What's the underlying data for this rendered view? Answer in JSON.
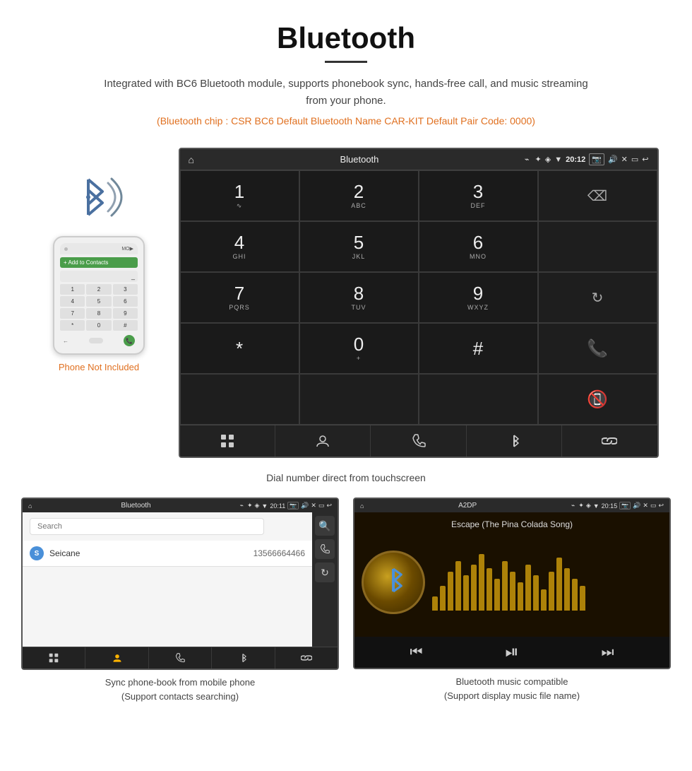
{
  "page": {
    "title": "Bluetooth",
    "title_underline": true,
    "description": "Integrated with BC6 Bluetooth module, supports phonebook sync, hands-free call, and music streaming from your phone.",
    "info_line": "(Bluetooth chip : CSR BC6    Default Bluetooth Name CAR-KIT    Default Pair Code: 0000)"
  },
  "dial_screen": {
    "status_bar": {
      "home_icon": "⌂",
      "title": "Bluetooth",
      "usb_icon": "⌁",
      "bt_icon": "✦",
      "location_icon": "◈",
      "signal_icon": "▼",
      "time": "20:12",
      "camera_icon": "◻",
      "volume_icon": "◁",
      "close_icon": "✕",
      "window_icon": "▭",
      "back_icon": "↩"
    },
    "keypad": [
      {
        "main": "1",
        "sub": "∿",
        "col": 1,
        "row": 1
      },
      {
        "main": "2",
        "sub": "ABC",
        "col": 2,
        "row": 1
      },
      {
        "main": "3",
        "sub": "DEF",
        "col": 3,
        "row": 1
      },
      {
        "main": "",
        "sub": "",
        "col": 4,
        "row": 1,
        "action": "backspace"
      },
      {
        "main": "4",
        "sub": "GHI",
        "col": 1,
        "row": 2
      },
      {
        "main": "5",
        "sub": "JKL",
        "col": 2,
        "row": 2
      },
      {
        "main": "6",
        "sub": "MNO",
        "col": 3,
        "row": 2
      },
      {
        "main": "",
        "sub": "",
        "col": 4,
        "row": 2,
        "action": "empty"
      },
      {
        "main": "7",
        "sub": "PQRS",
        "col": 1,
        "row": 3
      },
      {
        "main": "8",
        "sub": "TUV",
        "col": 2,
        "row": 3
      },
      {
        "main": "9",
        "sub": "WXYZ",
        "col": 3,
        "row": 3
      },
      {
        "main": "",
        "sub": "",
        "col": 4,
        "row": 3,
        "action": "refresh"
      },
      {
        "main": "*",
        "sub": "",
        "col": 1,
        "row": 4
      },
      {
        "main": "0",
        "sub": "+",
        "col": 2,
        "row": 4
      },
      {
        "main": "#",
        "sub": "",
        "col": 3,
        "row": 4
      },
      {
        "main": "",
        "sub": "",
        "col": 4,
        "row": 4,
        "action": "call"
      },
      {
        "main": "",
        "sub": "",
        "col": 4,
        "row": 5,
        "action": "end"
      }
    ],
    "toolbar_buttons": [
      "grid",
      "person",
      "phone",
      "bluetooth",
      "link"
    ],
    "caption": "Dial number direct from touchscreen"
  },
  "phone_side": {
    "not_included_text": "Phone Not Included"
  },
  "phonebook_screen": {
    "status_title": "Bluetooth",
    "time": "20:11",
    "search_placeholder": "Search",
    "contact": {
      "letter": "S",
      "name": "Seicane",
      "number": "13566664466"
    },
    "caption": "Sync phone-book from mobile phone\n(Support contacts searching)"
  },
  "music_screen": {
    "status_title": "A2DP",
    "time": "20:15",
    "song_title": "Escape (The Pina Colada Song)",
    "viz_bars": [
      20,
      35,
      55,
      70,
      50,
      65,
      80,
      60,
      45,
      70,
      55,
      40,
      65,
      50,
      30,
      55,
      75,
      60,
      45,
      35
    ],
    "caption": "Bluetooth music compatible\n(Support display music file name)"
  }
}
